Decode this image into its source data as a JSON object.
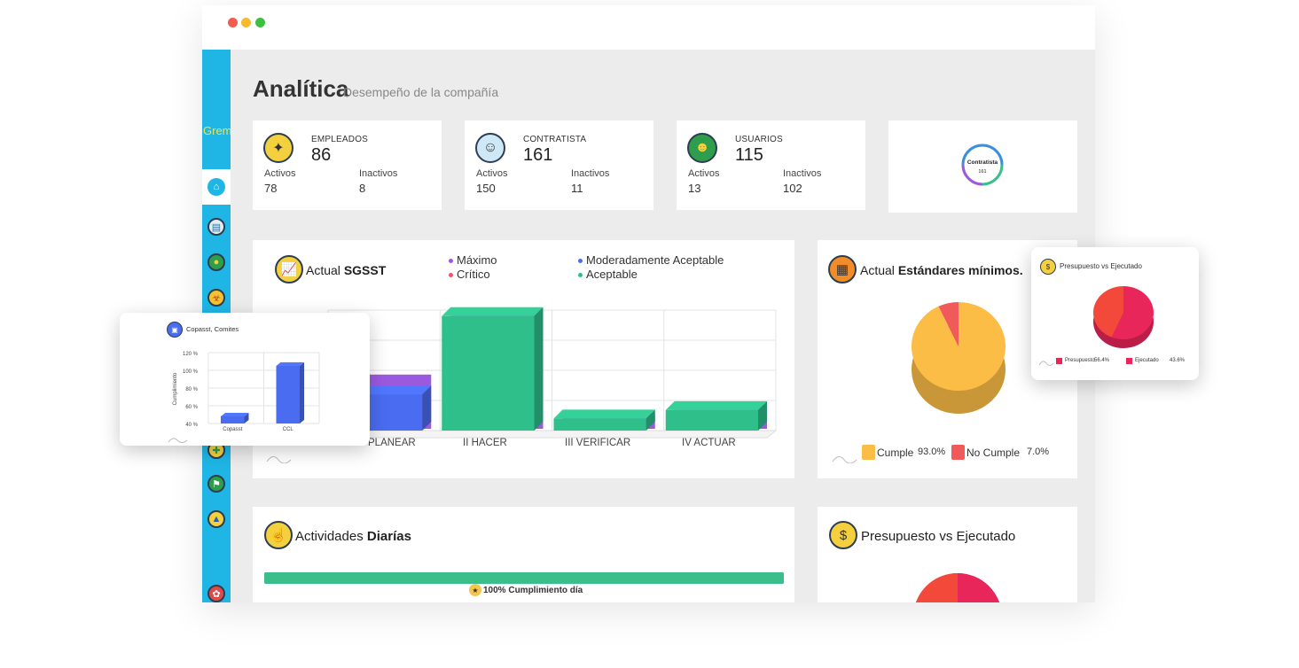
{
  "page": {
    "title": "Analítica",
    "subtitle": "Desempeño de la compañía",
    "brand": "Grem"
  },
  "sidebar": {
    "items": [
      {
        "icon": "home-icon"
      },
      {
        "icon": "document-icon"
      },
      {
        "icon": "user-icon"
      },
      {
        "icon": "biohazard-icon"
      },
      {
        "icon": "badge-icon"
      },
      {
        "icon": "flag-icon"
      },
      {
        "icon": "shield-icon"
      },
      {
        "icon": "leaf-icon"
      }
    ]
  },
  "stats": [
    {
      "label": "EMPLEADOS",
      "total": "86",
      "active_label": "Activos",
      "active": "78",
      "inactive_label": "Inactivos",
      "inactive": "8",
      "icon": "employees-icon"
    },
    {
      "label": "CONTRATISTA",
      "total": "161",
      "active_label": "Activos",
      "active": "150",
      "inactive_label": "Inactivos",
      "inactive": "11",
      "icon": "contractor-icon"
    },
    {
      "label": "USUARIOS",
      "total": "115",
      "active_label": "Activos",
      "active": "13",
      "inactive_label": "Inactivos",
      "inactive": "102",
      "icon": "users-icon"
    }
  ],
  "gauge": {
    "label": "Contratista",
    "value": "161"
  },
  "sgsst": {
    "title_prefix": "Actual",
    "title_bold": "SGSST",
    "legend": [
      {
        "label": "Máximo",
        "color": "#9b59e0"
      },
      {
        "label": "Crítico",
        "color": "#f0556a"
      },
      {
        "label": "Moderadamente Aceptable",
        "color": "#4a6cf0"
      },
      {
        "label": "Aceptable",
        "color": "#2fbf8a"
      }
    ]
  },
  "chart_data": [
    {
      "type": "bar",
      "categories": [
        "I PLANEAR",
        "II HACER",
        "III VERIFICAR",
        "IV ACTUAR"
      ],
      "visible_categories": [
        "PLANEAR",
        "II HACER",
        "III VERIFICAR",
        "IV ACTUAR"
      ],
      "series": [
        {
          "name": "Aceptable",
          "values": [
            30,
            95,
            10,
            17
          ]
        }
      ],
      "stack_top": [
        45,
        100,
        13,
        20
      ],
      "colors": [
        "#4a6cf0",
        "#2fbf8a",
        "#2fbf8a",
        "#2fbf8a"
      ],
      "top_color": "#9b59e0",
      "grid": true
    },
    {
      "type": "pie",
      "title": "Actual Estándares mínimos.",
      "labels": [
        "Cumple",
        "No Cumple"
      ],
      "values": [
        93.0,
        7.0
      ],
      "value_labels": [
        "93.0%",
        "7.0%"
      ],
      "colors": [
        "#fbbd45",
        "#f05a5a"
      ]
    },
    {
      "type": "pie",
      "title": "Presupuesto vs Ejecutado",
      "labels": [
        "Presupuesto",
        "Ejecutado"
      ],
      "values": [
        56.4,
        43.6
      ],
      "value_labels": [
        "56.4%",
        "43.6%"
      ],
      "colors": [
        "#e8265a",
        "#f2493a"
      ]
    },
    {
      "type": "bar",
      "title": "Copasst, Comites",
      "ylabel": "Cumplimiento",
      "categories": [
        "Copasst",
        "CCL"
      ],
      "values": [
        48,
        105
      ],
      "yticks": [
        "120 %",
        "100 %",
        "80 %",
        "60 %",
        "40 %"
      ],
      "ylim": [
        40,
        120
      ],
      "colors": [
        "#4a6cf0",
        "#4a6cf0"
      ]
    }
  ],
  "estandares": {
    "title_prefix": "Actual",
    "title_bold": "Estándares mínimos."
  },
  "budget_popup": {
    "title": "Presupuesto vs Ejecutado"
  },
  "copasst_popup": {
    "title": "Copasst, Comites"
  },
  "actividades": {
    "title_prefix": "Actividades",
    "title_bold": "Diarías",
    "progress": 100,
    "progress_label": "100% Cumplimiento día"
  },
  "budget_card": {
    "title": "Presupuesto vs Ejecutado"
  }
}
